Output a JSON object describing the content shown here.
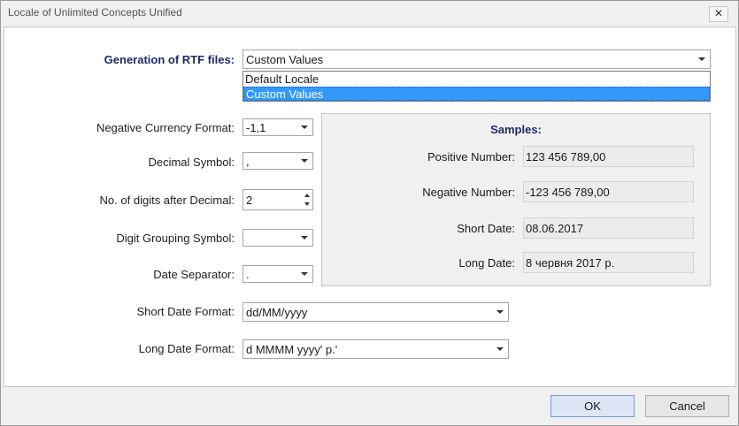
{
  "window": {
    "title": "Locale of Unlimited Concepts Unified",
    "close_glyph": "✕"
  },
  "rtf": {
    "label": "Generation of RTF files:",
    "value": "Custom Values",
    "options": [
      "Default Locale",
      "Custom Values"
    ]
  },
  "fields": {
    "negative_currency": {
      "label": "Negative Currency Format:",
      "value": "-1,1"
    },
    "decimal_symbol": {
      "label": "Decimal Symbol:",
      "value": ","
    },
    "digits_after_decimal": {
      "label": "No. of digits after Decimal:",
      "value": "2"
    },
    "digit_grouping": {
      "label": "Digit Grouping Symbol:",
      "value": ""
    },
    "date_separator": {
      "label": "Date Separator:",
      "value": "."
    },
    "short_date_format": {
      "label": "Short Date Format:",
      "value": "dd/MM/yyyy"
    },
    "long_date_format": {
      "label": "Long Date Format:",
      "value": "d MMMM yyyy' р.'"
    }
  },
  "samples": {
    "title": "Samples:",
    "positive_number": {
      "label": "Positive Number:",
      "value": "123 456 789,00"
    },
    "negative_number": {
      "label": "Negative Number:",
      "value": "-123 456 789,00"
    },
    "short_date": {
      "label": "Short Date:",
      "value": "08.06.2017"
    },
    "long_date": {
      "label": "Long Date:",
      "value": "8 червня 2017 р."
    }
  },
  "buttons": {
    "ok": "OK",
    "cancel": "Cancel"
  },
  "colors": {
    "selection": "#3399ff",
    "label_bold": "#1f2a6b",
    "ok_bg": "#dde6f7"
  }
}
